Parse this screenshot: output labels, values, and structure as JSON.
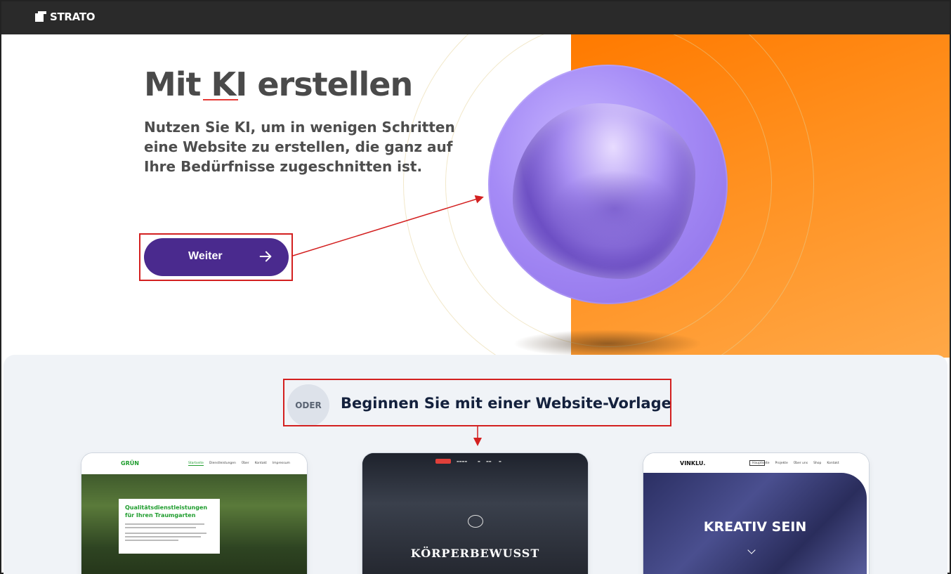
{
  "header": {
    "brand": "STRATO"
  },
  "hero": {
    "title": "Mit KI erstellen",
    "subtitle": "Nutzen Sie KI, um in wenigen Schritten eine Website zu erstellen, die ganz auf Ihre Bedürfnisse zugeschnitten ist.",
    "button_label": "Weiter"
  },
  "template_section": {
    "oder_label": "ODER",
    "title": "Beginnen Sie mit einer Website-Vorlage"
  },
  "templates": [
    {
      "brand": "GRÜN",
      "nav": [
        "Startseite",
        "Dienstleistungen",
        "Über",
        "Kontakt",
        "Impressum"
      ],
      "headline": "Qualitätsdienstleistungen für Ihren Traumgarten"
    },
    {
      "headline": "KÖRPERBEWUSST"
    },
    {
      "brand": "VINKLU.",
      "nav": [
        "Hauptseite",
        "Projekte",
        "Über uns",
        "Shop",
        "Kontakt"
      ],
      "headline": "KREATIV SEIN"
    }
  ],
  "colors": {
    "primary_button": "#4a2a8e",
    "accent_orange": "#ff7a00",
    "annotation_red": "#d32020",
    "topbar": "#2a2a2a"
  }
}
